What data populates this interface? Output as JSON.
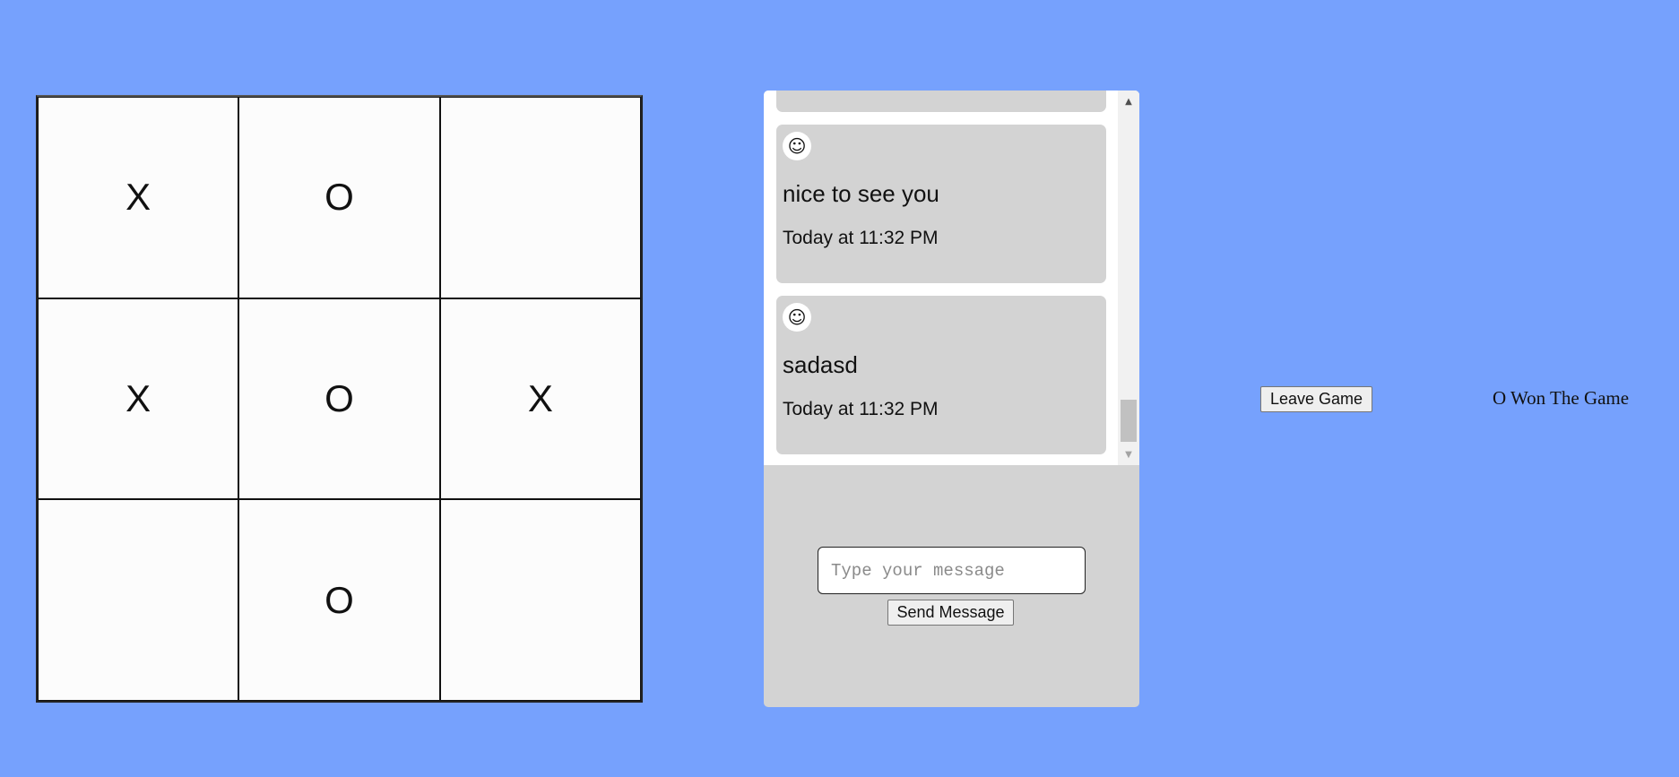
{
  "board": {
    "cells": [
      "X",
      "O",
      "",
      "X",
      "O",
      "X",
      "",
      "O",
      ""
    ]
  },
  "chat": {
    "messages": [
      {
        "avatar_icon": "smiley-icon",
        "avatar_glyph": "☺",
        "text": "",
        "time": ""
      },
      {
        "avatar_icon": "smiley-icon",
        "avatar_glyph": "☺",
        "text": "nice to see you",
        "time": "Today at 11:32 PM"
      },
      {
        "avatar_icon": "smiley-icon",
        "avatar_glyph": "☺",
        "text": "sadasd",
        "time": "Today at 11:32 PM"
      }
    ],
    "input_placeholder": "Type your message",
    "input_value": "",
    "send_label": "Send Message"
  },
  "controls": {
    "leave_label": "Leave Game"
  },
  "status_text": "O Won The Game",
  "colors": {
    "background": "#76a1fd",
    "chat_panel": "#d3d3d3",
    "message_bubble": "#d3d3d3"
  }
}
